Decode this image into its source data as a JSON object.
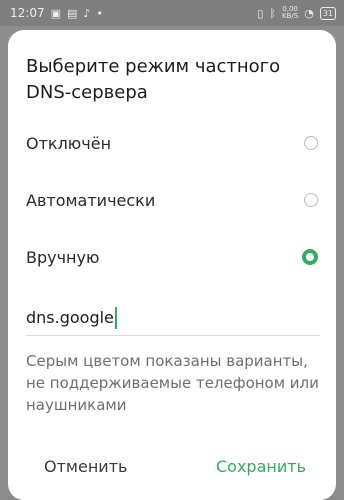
{
  "status_bar": {
    "time": "12:07",
    "net_speed_value": "0,00",
    "net_speed_unit": "KB/S",
    "battery": "31"
  },
  "dialog": {
    "title": "Выберите режим частного DNS-сервера",
    "options": [
      {
        "label": "Отключён",
        "checked": false
      },
      {
        "label": "Автоматически",
        "checked": false
      },
      {
        "label": "Вручную",
        "checked": true
      }
    ],
    "hostname_value": "dns.google",
    "note": "Серым цветом показаны варианты, не поддерживаемые телефоном или наушниками",
    "cancel_label": "Отменить",
    "save_label": "Сохранить"
  },
  "colors": {
    "accent": "#2fae5b",
    "scrim": "#8d8d8d"
  }
}
